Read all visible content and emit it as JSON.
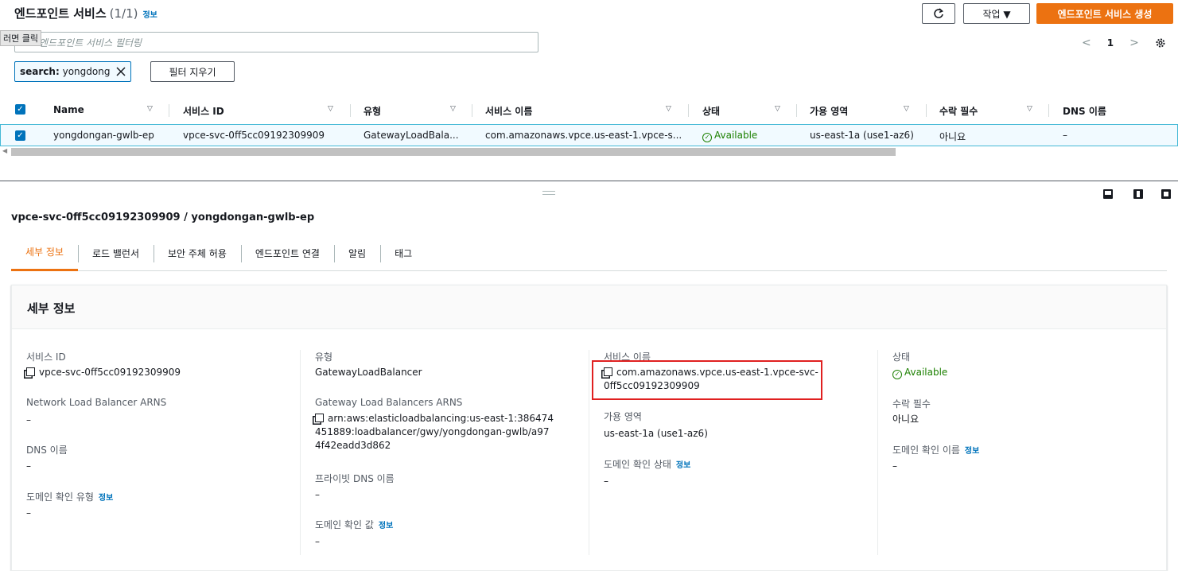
{
  "header": {
    "title": "엔드포인트 서비스",
    "count": "(1/1)",
    "info": "정보",
    "actions_label": "작업 ▼",
    "create_label": "엔드포인트 서비스 생성"
  },
  "tooltip": "러면 클릭",
  "search": {
    "placeholder": "엔드포인트 서비스 필터링"
  },
  "filter_token": {
    "key": "search:",
    "value": "yongdong"
  },
  "clear_filters_label": "필터 지우기",
  "pagination": {
    "prev": "<",
    "page": "1",
    "next": ">"
  },
  "table": {
    "columns": [
      "Name",
      "서비스 ID",
      "유형",
      "서비스 이름",
      "상태",
      "가용 영역",
      "수락 필수",
      "DNS 이름"
    ],
    "rows": [
      {
        "name": "yongdongan-gwlb-ep",
        "service_id": "vpce-svc-0ff5cc09192309909",
        "type": "GatewayLoadBala...",
        "service_name": "com.amazonaws.vpce.us-east-1.vpce-s...",
        "status": "Available",
        "az": "us-east-1a (use1-az6)",
        "acceptance": "아니요",
        "dns": "–"
      }
    ]
  },
  "panel": {
    "title": "vpce-svc-0ff5cc09192309909 / yongdongan-gwlb-ep",
    "tabs": [
      "세부 정보",
      "로드 밸런서",
      "보안 주체 허용",
      "엔드포인트 연결",
      "알림",
      "태그"
    ],
    "active_tab": "세부 정보"
  },
  "details": {
    "title": "세부 정보",
    "col1": {
      "service_id_label": "서비스 ID",
      "service_id_value": "vpce-svc-0ff5cc09192309909",
      "nlb_label": "Network Load Balancer ARNS",
      "nlb_value": "–",
      "dns_label": "DNS 이름",
      "dns_value": "–",
      "domain_type_label": "도메인 확인 유형",
      "domain_type_info": "정보",
      "domain_type_value": "–"
    },
    "col2": {
      "type_label": "유형",
      "type_value": "GatewayLoadBalancer",
      "gwlb_label": "Gateway Load Balancers ARNS",
      "gwlb_value": "arn:aws:elasticloadbalancing:us-east-1:386474451889:loadbalancer/gwy/yongdongan-gwlb/a974f42eadd3d862",
      "private_dns_label": "프라이빗 DNS 이름",
      "private_dns_value": "–",
      "domain_value_label": "도메인 확인 값",
      "domain_value_info": "정보",
      "domain_value_value": "–"
    },
    "col3": {
      "service_name_label": "서비스 이름",
      "service_name_value": "com.amazonaws.vpce.us-east-1.vpce-svc-0ff5cc09192309909",
      "az_label": "가용 영역",
      "az_value": "us-east-1a (use1-az6)",
      "domain_status_label": "도메인 확인 상태",
      "domain_status_info": "정보",
      "domain_status_value": "–"
    },
    "col4": {
      "status_label": "상태",
      "status_value": "Available",
      "acceptance_label": "수락 필수",
      "acceptance_value": "아니요",
      "domain_name_label": "도메인 확인 이름",
      "domain_name_info": "정보",
      "domain_name_value": "–"
    }
  },
  "colors": {
    "accent": "#ec7211",
    "link": "#0073bb",
    "success": "#1d8102",
    "highlight": "#e02020"
  }
}
